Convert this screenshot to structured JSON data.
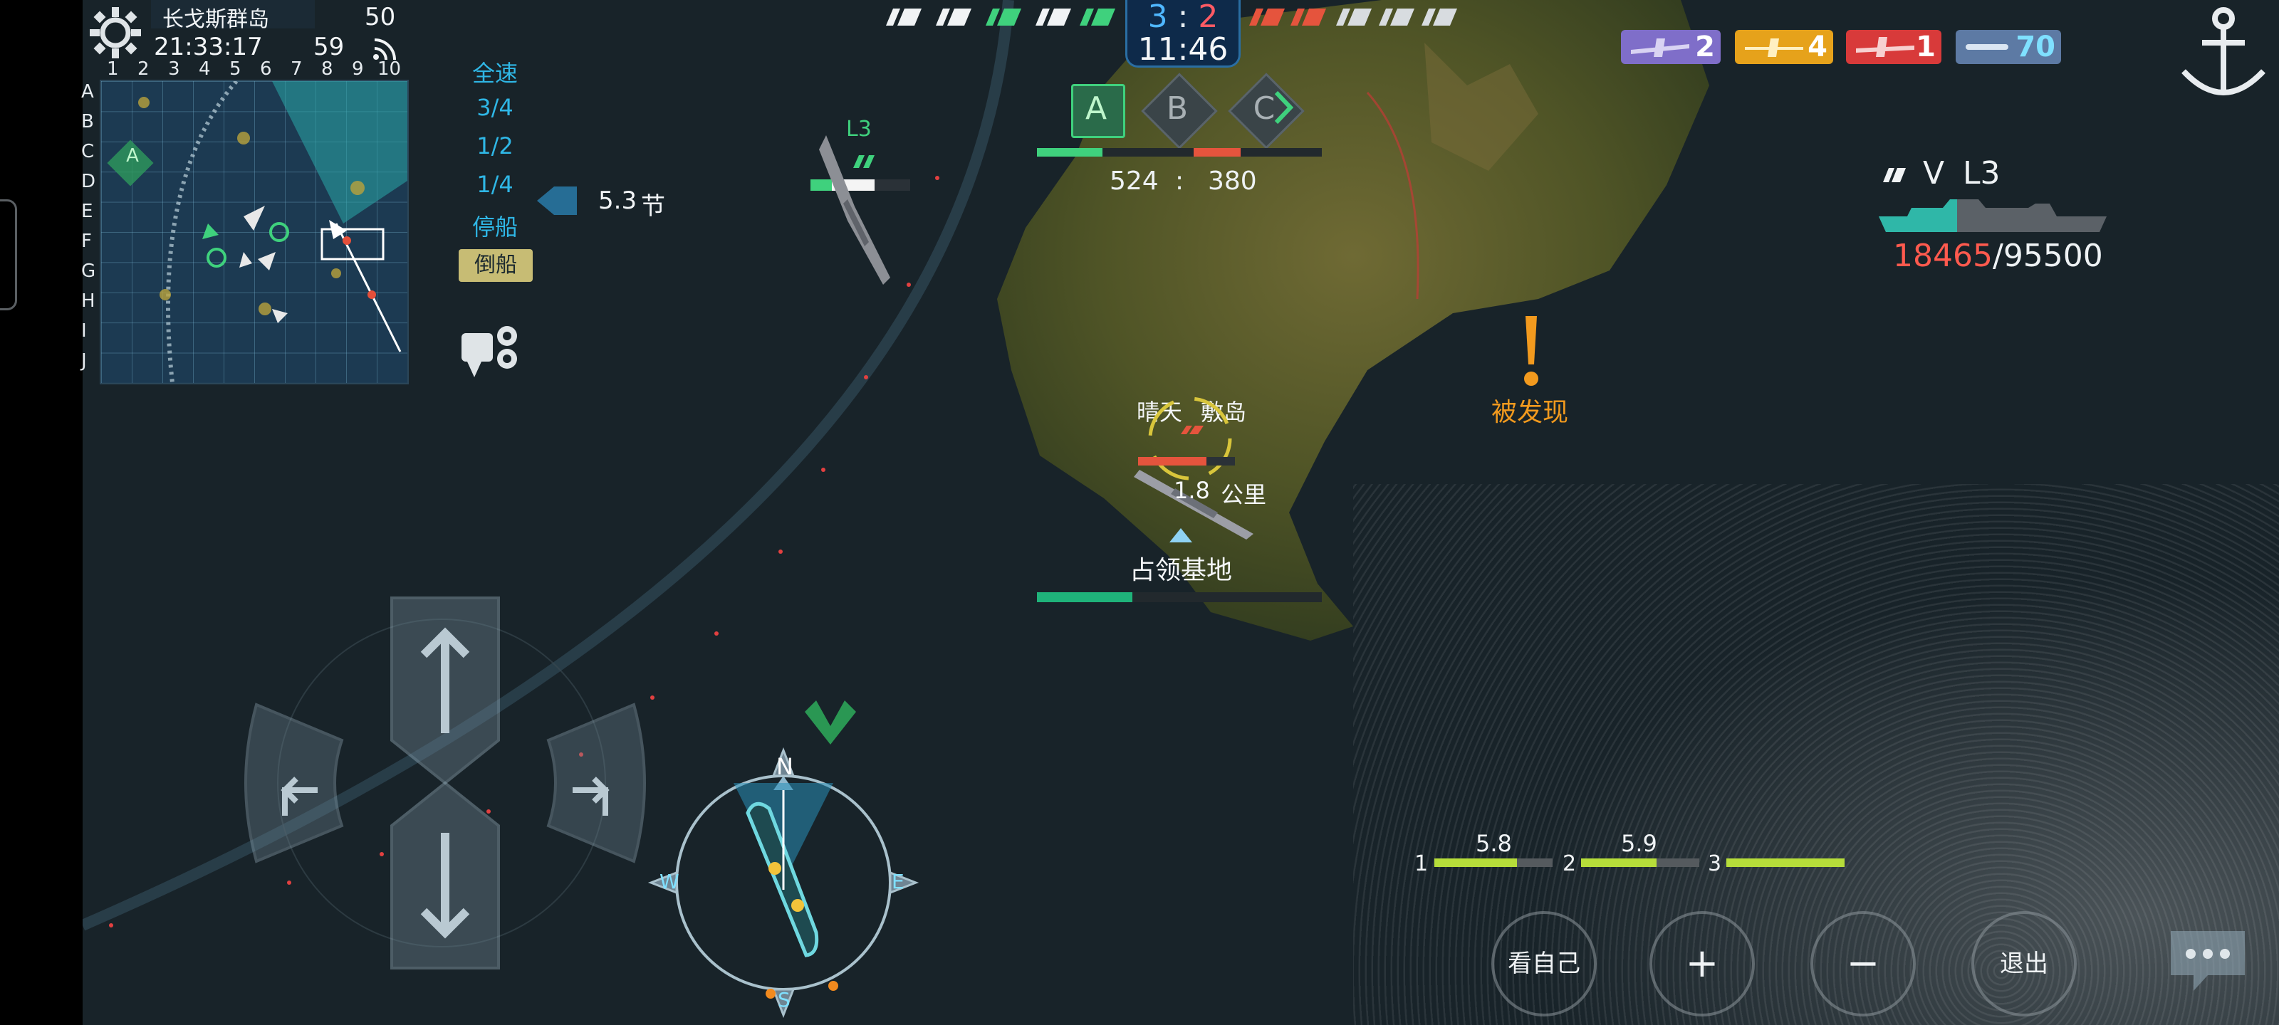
{
  "header": {
    "map_name": "长戈斯群岛",
    "clock": "21:33:17",
    "ping": "59",
    "fps": "50"
  },
  "minimap": {
    "cols": [
      "1",
      "2",
      "3",
      "4",
      "5",
      "6",
      "7",
      "8",
      "9",
      "10"
    ],
    "rows": [
      "A",
      "B",
      "C",
      "D",
      "E",
      "F",
      "G",
      "H",
      "I",
      "J"
    ],
    "point_label": "A"
  },
  "speed": {
    "levels": [
      "全速",
      "3/4",
      "1/2",
      "1/4",
      "停船"
    ],
    "reverse": "倒船",
    "current_value": "5.3",
    "current_unit": "节"
  },
  "score": {
    "blue": "3",
    "sep": ":",
    "red": "2",
    "timer": "11:46"
  },
  "capture_points": [
    "A",
    "B",
    "C"
  ],
  "points": {
    "blue": "524",
    "sep": ":",
    "red": "380"
  },
  "resources": [
    {
      "name": "bomber",
      "count": "2",
      "color": "#7f6ec9"
    },
    {
      "name": "torpedo-plane",
      "count": "4",
      "color": "#e6a21b"
    },
    {
      "name": "fighter",
      "count": "1",
      "color": "#d83a3a"
    },
    {
      "name": "torpedo",
      "count": "70",
      "color": "#5d7aa4"
    }
  ],
  "target_ship": {
    "tier": "V",
    "name": "L3",
    "hp_current": "18465",
    "hp_sep": "/",
    "hp_max": "95500"
  },
  "ally_ship": {
    "name": "L3"
  },
  "enemy_marker": {
    "status": "晴天",
    "ship_type": "敷岛",
    "distance": "1.8",
    "distance_unit": "公里"
  },
  "objective": {
    "label": "占领基地"
  },
  "detected": {
    "label": "被发现"
  },
  "weapons": [
    {
      "index": "1",
      "reload": "5.8"
    },
    {
      "index": "2",
      "reload": "5.9"
    },
    {
      "index": "3",
      "reload": ""
    }
  ],
  "controls": {
    "view_self": "看自己",
    "zoom_in": "+",
    "zoom_out": "−",
    "exit": "退出"
  },
  "compass": {
    "n": "N",
    "e": "E",
    "s": "S",
    "w": "W"
  },
  "colors": {
    "blue_team": "#3fc37e",
    "red_team": "#e5543d",
    "score_blue": "#4fb7ff",
    "score_red": "#ff5a64",
    "hp_red": "#ff5a4e",
    "accent": "#2fb7e6"
  }
}
